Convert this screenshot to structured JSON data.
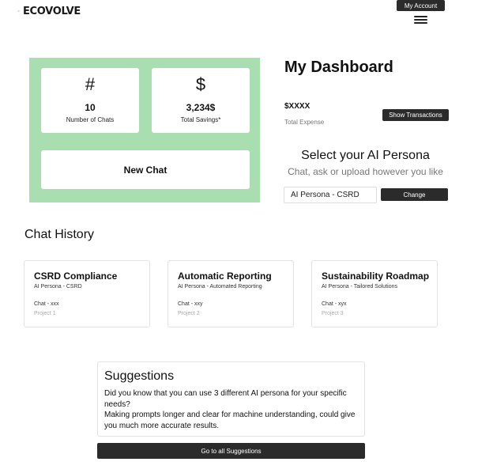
{
  "header": {
    "brand": "ECOVOLVE",
    "my_account_label": "My Account",
    "menu_icon": "hamburger-icon"
  },
  "stats": {
    "chats": {
      "icon": "#",
      "value": "10",
      "label": "Number of Chats"
    },
    "savings": {
      "icon": "$",
      "value": "3,234$",
      "label": "Total Savings*"
    },
    "new_chat_label": "New Chat",
    "panel_color": "#a9dfb0"
  },
  "dashboard": {
    "title": "My Dashboard",
    "expense_value": "$XXXX",
    "expense_label": "Total Expense",
    "show_transactions_label": "Show Transactions"
  },
  "persona": {
    "title": "Select your AI Persona",
    "subtitle": "Chat, ask or upload however you like",
    "current_value": "AI Persona - CSRD",
    "change_label": "Change"
  },
  "history": {
    "title": "Chat History",
    "cards": [
      {
        "title": "CSRD Compliance",
        "persona": "AI Persona - CSRD",
        "chat": "Chat - xxx",
        "project": "Project 1"
      },
      {
        "title": "Automatic Reporting",
        "persona": "AI Persona - Automated Reporting",
        "chat": "Chat - xxy",
        "project": "Project 2"
      },
      {
        "title": "Sustainability Roadmap",
        "persona": "AI Persona - Tailored Solutions",
        "chat": "Chat - xyx",
        "project": "Project 3"
      }
    ]
  },
  "suggestions": {
    "title": "Suggestions",
    "line1": "Did you know that you can use 3 different AI persona for your specific needs?",
    "line2": "Making prompts longer and clear for machine understanding, could give you much more accurate results.",
    "button_label": "Go to all Suggestions"
  }
}
